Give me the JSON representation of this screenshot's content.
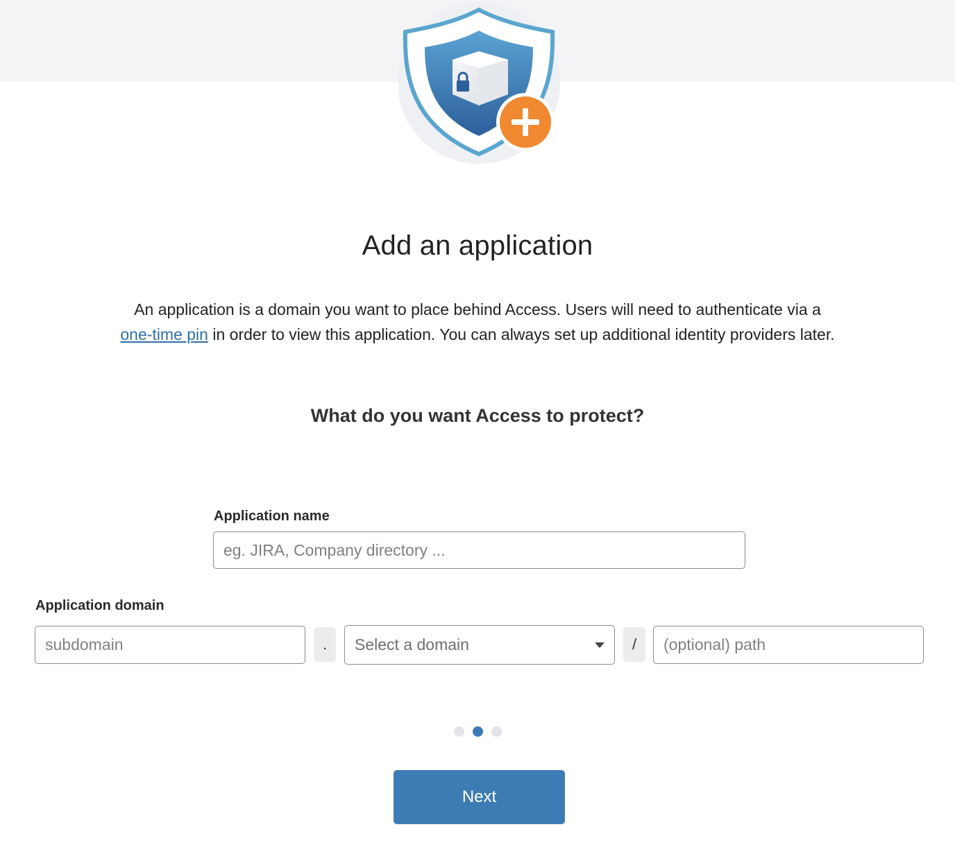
{
  "page": {
    "title": "Add an application",
    "description_before_link": "An application is a domain you want to place behind Access. Users will need to authenticate via a ",
    "description_link": "one-time pin",
    "description_after_link": " in order to view this application. You can always set up additional identity providers later.",
    "subheading": "What do you want Access to protect?"
  },
  "hero": {
    "icon": "shield-lock-plus-icon"
  },
  "form": {
    "app_name_label": "Application name",
    "app_name_placeholder": "eg. JIRA, Company directory ...",
    "app_domain_label": "Application domain",
    "subdomain_placeholder": "subdomain",
    "dot_separator": ".",
    "domain_select_value": "Select a domain",
    "slash_separator": "/",
    "path_placeholder": "(optional) path"
  },
  "stepper": {
    "total": 3,
    "current": 2
  },
  "actions": {
    "next_label": "Next"
  },
  "colors": {
    "accent": "#3d7bb4",
    "link": "#2f6faa",
    "plus_badge": "#f0892f",
    "top_band": "#f4f4f6"
  }
}
